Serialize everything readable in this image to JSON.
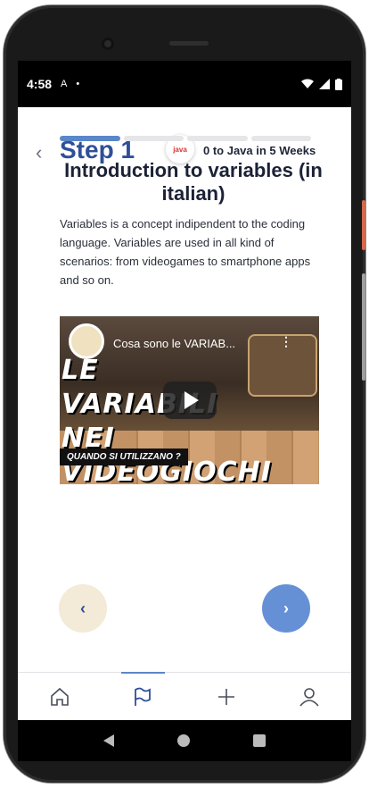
{
  "status_bar": {
    "time": "4:58",
    "notif_icon": "A",
    "dot": "•"
  },
  "header": {
    "back_icon": "‹",
    "step_title": "Step 1",
    "course_logo_text": "java",
    "course_name": "0 to Java in 5 Weeks"
  },
  "progress": {
    "segments": 4,
    "current": 1
  },
  "lesson": {
    "title": "Introduction to variables (in italian)",
    "description": "Variables is a concept indipendent to the coding language. Variables are used in all kind of scenarios: from videogames to smartphone apps and so on."
  },
  "video": {
    "title": "Cosa sono le VARIAB...",
    "thumbnail_headline_1": "LE VARIABILI",
    "thumbnail_headline_2": "NEI VIDEOGIOCHI",
    "thumbnail_tag": "QUANDO SI UTILIZZANO ?",
    "menu_icon": "⋮"
  },
  "navigation": {
    "prev_icon": "‹",
    "next_icon": "›"
  },
  "tabbar": {
    "items": [
      {
        "name": "home",
        "icon": "home-icon"
      },
      {
        "name": "steps",
        "icon": "flag-icon",
        "active": true
      },
      {
        "name": "add",
        "icon": "plus-icon"
      },
      {
        "name": "profile",
        "icon": "user-icon"
      }
    ]
  },
  "colors": {
    "accent": "#5b86c9",
    "title": "#2f4f98",
    "prev_button": "#f3ead7",
    "next_button": "#6690d6"
  }
}
